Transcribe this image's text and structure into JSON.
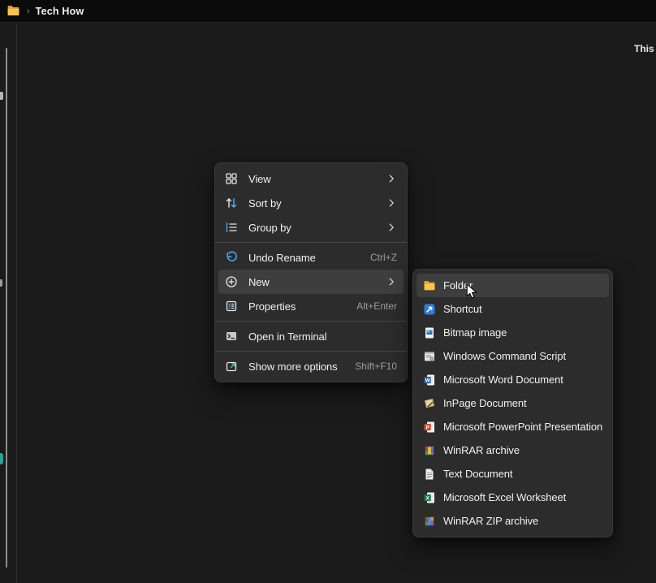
{
  "window": {
    "titlebar": {
      "breadcrumb_location": "Tech How",
      "breadcrumb_separator": "›"
    },
    "empty_message_partial": "This f"
  },
  "colors": {
    "titlebar_bg": "#0b0b0b",
    "content_bg": "#1b1b1b",
    "menu_bg": "#2c2c2c",
    "menu_highlight": "#3e3e3e",
    "text_primary": "#f0f0f0",
    "text_secondary": "#9e9e9e",
    "accent_blue": "#4da6ff",
    "folder_yellow": "#f6c64a",
    "scrollbar": "#8f8f8f"
  },
  "context_menu": {
    "items": [
      {
        "label": "View",
        "icon": "view-icon",
        "submenu": true
      },
      {
        "label": "Sort by",
        "icon": "sort-icon",
        "submenu": true
      },
      {
        "label": "Group by",
        "icon": "group-icon",
        "submenu": true
      },
      {
        "type": "separator"
      },
      {
        "label": "Undo Rename",
        "icon": "undo-icon",
        "shortcut": "Ctrl+Z"
      },
      {
        "label": "New",
        "icon": "new-icon",
        "submenu": true,
        "highlighted": true
      },
      {
        "label": "Properties",
        "icon": "properties-icon",
        "shortcut": "Alt+Enter"
      },
      {
        "type": "separator"
      },
      {
        "label": "Open in Terminal",
        "icon": "terminal-icon"
      },
      {
        "type": "separator"
      },
      {
        "label": "Show more options",
        "icon": "show-more-icon",
        "shortcut": "Shift+F10"
      }
    ]
  },
  "new_submenu": {
    "items": [
      {
        "label": "Folder",
        "icon": "folder-icon",
        "highlighted": true
      },
      {
        "label": "Shortcut",
        "icon": "shortcut-icon"
      },
      {
        "label": "Bitmap image",
        "icon": "bitmap-icon"
      },
      {
        "label": "Windows Command Script",
        "icon": "cmd-script-icon"
      },
      {
        "label": "Microsoft Word Document",
        "icon": "word-icon"
      },
      {
        "label": "InPage Document",
        "icon": "inpage-icon"
      },
      {
        "label": "Microsoft PowerPoint Presentation",
        "icon": "powerpoint-icon"
      },
      {
        "label": "WinRAR archive",
        "icon": "winrar-icon"
      },
      {
        "label": "Text Document",
        "icon": "text-doc-icon"
      },
      {
        "label": "Microsoft Excel Worksheet",
        "icon": "excel-icon"
      },
      {
        "label": "WinRAR ZIP archive",
        "icon": "winrar-zip-icon"
      }
    ]
  }
}
